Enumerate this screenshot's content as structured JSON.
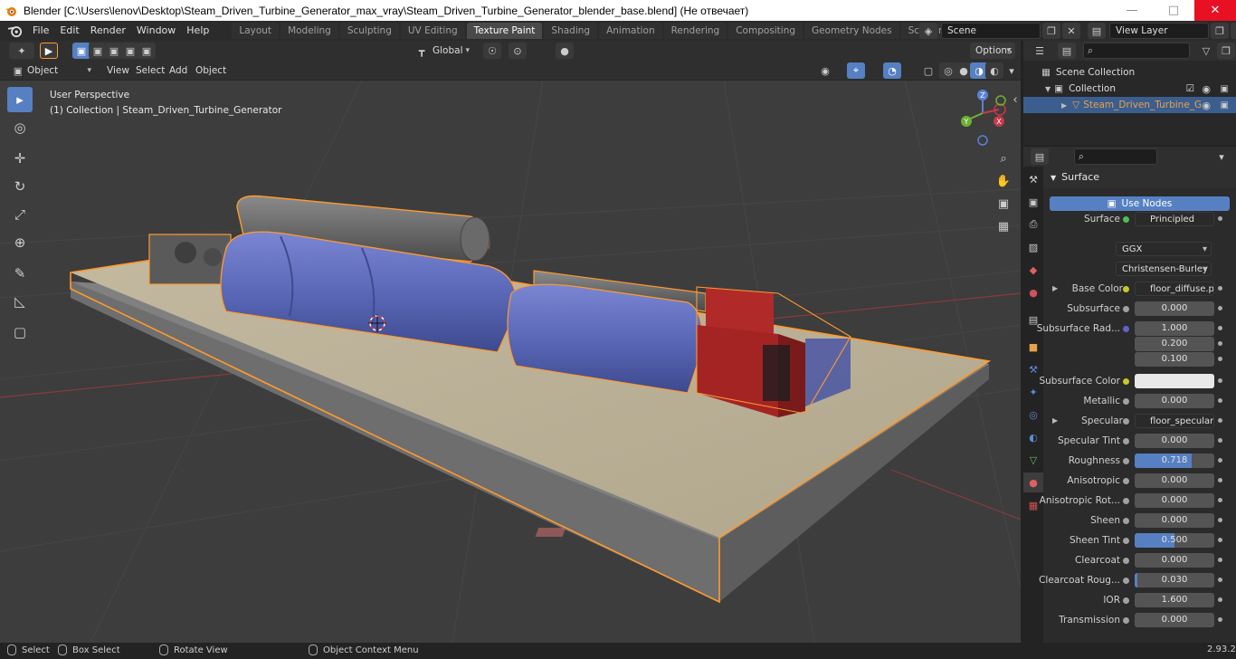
{
  "window": {
    "title": "Blender [C:\\Users\\lenov\\Desktop\\Steam_Driven_Turbine_Generator_max_vray\\Steam_Driven_Turbine_Generator_blender_base.blend] (Не отвечает)"
  },
  "menu": [
    "File",
    "Edit",
    "Render",
    "Window",
    "Help"
  ],
  "workspaces": [
    "Layout",
    "Modeling",
    "Sculpting",
    "UV Editing",
    "Texture Paint",
    "Shading",
    "Animation",
    "Rendering",
    "Compositing",
    "Geometry Nodes",
    "Scripting"
  ],
  "active_workspace": "Texture Paint",
  "scene": {
    "name": "Scene",
    "view_layer": "View Layer"
  },
  "toolbar_header": {
    "orientation": "Global",
    "options": "Options"
  },
  "viewport_header": {
    "mode": "Object Mode",
    "menus": [
      "View",
      "Select",
      "Add",
      "Object"
    ]
  },
  "viewport": {
    "perspective_label": "User Perspective",
    "collection_label": "(1) Collection | Steam_Driven_Turbine_Generator",
    "gizmo": {
      "x": "X",
      "y": "Y",
      "z": "Z"
    }
  },
  "outliner": {
    "root": "Scene Collection",
    "collection": "Collection",
    "object": "Steam_Driven_Turbine_G"
  },
  "properties": {
    "section": "Surface",
    "use_nodes": "Use Nodes",
    "rows": [
      {
        "label": "Surface",
        "value": "Principled BSDF",
        "kind": "text",
        "dot": "#4fbf4f"
      },
      {
        "label": "",
        "value": "GGX",
        "kind": "dropdown"
      },
      {
        "label": "",
        "value": "Christensen-Burley",
        "kind": "dropdown"
      },
      {
        "label": "Base Color",
        "value": "floor_diffuse.png",
        "kind": "text",
        "dot": "#c7c729",
        "expand": true
      },
      {
        "label": "Subsurface",
        "value": "0.000",
        "kind": "number",
        "dot": "#a1a1a1",
        "fill": 0
      },
      {
        "label": "Subsurface Rad...",
        "value": "1.000",
        "kind": "number",
        "dot": "#6363c7",
        "fill": 0
      },
      {
        "label": "",
        "value": "0.200",
        "kind": "number",
        "fill": 0
      },
      {
        "label": "",
        "value": "0.100",
        "kind": "number",
        "fill": 0
      },
      {
        "label": "Subsurface Color",
        "value": "",
        "kind": "color",
        "dot": "#c7c729"
      },
      {
        "label": "Metallic",
        "value": "0.000",
        "kind": "number",
        "dot": "#a1a1a1",
        "fill": 0
      },
      {
        "label": "Specular",
        "value": "floor_specular.png",
        "kind": "text",
        "dot": "#a1a1a1",
        "expand": true
      },
      {
        "label": "Specular Tint",
        "value": "0.000",
        "kind": "number",
        "dot": "#a1a1a1",
        "fill": 0
      },
      {
        "label": "Roughness",
        "value": "0.718",
        "kind": "number",
        "dot": "#a1a1a1",
        "fill": 0.718
      },
      {
        "label": "Anisotropic",
        "value": "0.000",
        "kind": "number",
        "dot": "#a1a1a1",
        "fill": 0
      },
      {
        "label": "Anisotropic Rot...",
        "value": "0.000",
        "kind": "number",
        "dot": "#a1a1a1",
        "fill": 0
      },
      {
        "label": "Sheen",
        "value": "0.000",
        "kind": "number",
        "dot": "#a1a1a1",
        "fill": 0
      },
      {
        "label": "Sheen Tint",
        "value": "0.500",
        "kind": "number",
        "dot": "#a1a1a1",
        "fill": 0.5
      },
      {
        "label": "Clearcoat",
        "value": "0.000",
        "kind": "number",
        "dot": "#a1a1a1",
        "fill": 0
      },
      {
        "label": "Clearcoat Roug...",
        "value": "0.030",
        "kind": "number",
        "dot": "#a1a1a1",
        "fill": 0.03
      },
      {
        "label": "IOR",
        "value": "1.600",
        "kind": "number",
        "dot": "#a1a1a1",
        "fill": 0
      },
      {
        "label": "Transmission",
        "value": "0.000",
        "kind": "number",
        "dot": "#a1a1a1",
        "fill": 0
      }
    ]
  },
  "statusbar": {
    "select": "Select",
    "box_select": "Box Select",
    "rotate_view": "Rotate View",
    "context_menu": "Object Context Menu",
    "version": "2.93.2"
  },
  "colors": {
    "accent": "#5680c2",
    "selection_outline": "#ff9a2e",
    "turbine_blue": "#5a68b8",
    "generator_red": "#b02a2a",
    "floor": "#bdb39a"
  }
}
